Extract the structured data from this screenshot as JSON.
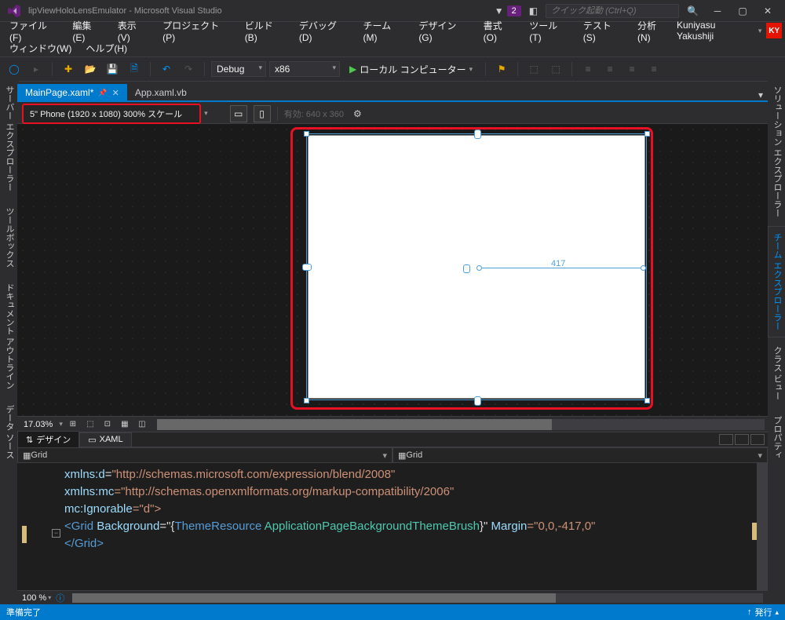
{
  "window": {
    "title": "lipViewHoloLensEmulator - Microsoft Visual Studio",
    "notification_count": "2",
    "search_placeholder": "クイック起動 (Ctrl+Q)"
  },
  "user": {
    "name": "Kuniyasu Yakushiji",
    "initials": "KY"
  },
  "menu": {
    "file": "ファイル(F)",
    "edit": "編集(E)",
    "view": "表示(V)",
    "project": "プロジェクト(P)",
    "build": "ビルド(B)",
    "debug": "デバッグ(D)",
    "team": "チーム(M)",
    "design": "デザイン(G)",
    "format": "書式(O)",
    "tools": "ツール(T)",
    "test": "テスト(S)",
    "analyze": "分析(N)",
    "window": "ウィンドウ(W)",
    "help": "ヘルプ(H)"
  },
  "toolbar": {
    "config": "Debug",
    "platform": "x86",
    "run_target": "ローカル コンピューター"
  },
  "side": {
    "left": [
      "サーバー エクスプローラー",
      "ツールボックス",
      "ドキュメント アウトライン",
      "データ ソース"
    ],
    "right": [
      "ソリューション エクスプローラー",
      "チーム エクスプローラー",
      "クラス ビュー",
      "プロパティ"
    ],
    "right_active_index": 1
  },
  "tabs": [
    {
      "label": "MainPage.xaml*",
      "active": true
    },
    {
      "label": "App.xaml.vb",
      "active": false
    }
  ],
  "designer": {
    "device": "5\" Phone (1920 x 1080) 300% スケール",
    "effective": "有効: 640 x 360",
    "measure": "417"
  },
  "zoom": {
    "percent": "17.03%"
  },
  "split": {
    "design": "デザイン",
    "xaml": "XAML"
  },
  "breadcrumb": {
    "left": "Grid",
    "right": "Grid"
  },
  "code": {
    "l1a": "xmlns:d",
    "l1b": "=",
    "l1c": "\"http://schemas.microsoft.com/expression/blend/2008\"",
    "l2a": "xmlns:mc",
    "l2b": "=\"http://schemas.openxmlformats.org/markup-compatibility/2006\"",
    "l3a": "mc:Ignorable",
    "l3b": "=\"d\">",
    "l4": "",
    "l5a": "<",
    "l5b": "Grid",
    "l5c": " Background",
    "l5d": "=\"{",
    "l5e": "ThemeResource",
    "l5f": " ApplicationPageBackgroundThemeBrush",
    "l5g": "}\"",
    "l5h": " Margin",
    "l5i": "=\"0,0,-417,0\"",
    "l6a": "</",
    "l6b": "Grid",
    "l6c": ">"
  },
  "editor_status": {
    "zoom": "100 %"
  },
  "status": {
    "ready": "準備完了",
    "publish": "発行"
  }
}
